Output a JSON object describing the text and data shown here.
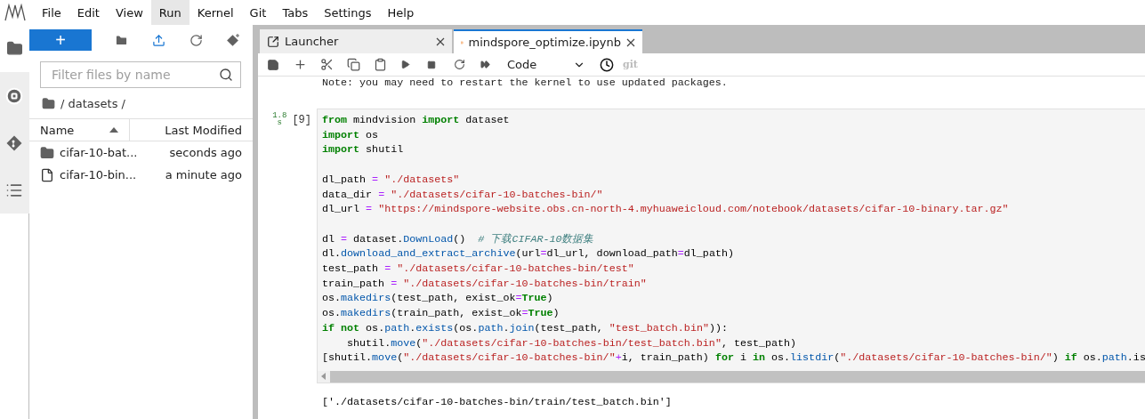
{
  "menu": [
    {
      "label": "File",
      "selected": false
    },
    {
      "label": "Edit",
      "selected": false
    },
    {
      "label": "View",
      "selected": false
    },
    {
      "label": "Run",
      "selected": true
    },
    {
      "label": "Kernel",
      "selected": false
    },
    {
      "label": "Git",
      "selected": false
    },
    {
      "label": "Tabs",
      "selected": false
    },
    {
      "label": "Settings",
      "selected": false
    },
    {
      "label": "Help",
      "selected": false
    }
  ],
  "side_tabs": [
    {
      "kind": "folder",
      "selected": true
    },
    {
      "kind": "stop",
      "selected": false
    },
    {
      "kind": "git",
      "selected": false
    },
    {
      "kind": "list",
      "selected": false
    }
  ],
  "file_browser": {
    "new_button": "+",
    "filter": {
      "placeholder": "Filter files by name"
    },
    "path": "/ datasets /",
    "columns": [
      {
        "label": "Name",
        "sorted": true
      },
      {
        "label": "Last Modified",
        "sorted": false
      }
    ],
    "rows": [
      {
        "kind": "folder",
        "name": "cifar-10-bat...",
        "modified": "seconds ago"
      },
      {
        "kind": "file",
        "name": "cifar-10-bin...",
        "modified": "a minute ago"
      }
    ]
  },
  "tabs": [
    {
      "kind": "launcher",
      "label": "Launcher",
      "selected": false
    },
    {
      "kind": "notebook",
      "label": "mindspore_optimize.ipynb",
      "selected": true
    }
  ],
  "toolbar": {
    "cell_type": "Code",
    "git": "git"
  },
  "notebook": {
    "note": "Note: you may need to restart the kernel to use updated packages.",
    "cell": {
      "time": "1.8",
      "time_unit": "s",
      "prompt": "[9]",
      "blocks": [
        [
          [
            {
              "kind": "kw",
              "text": "from"
            },
            {
              "kind": "plain",
              "text": " mindvision "
            },
            {
              "kind": "kw",
              "text": "import"
            },
            {
              "kind": "plain",
              "text": " dataset"
            }
          ],
          [
            {
              "kind": "kw",
              "text": "import"
            },
            {
              "kind": "plain",
              "text": " os"
            }
          ],
          [
            {
              "kind": "kw",
              "text": "import"
            },
            {
              "kind": "plain",
              "text": " shutil"
            }
          ]
        ],
        [
          [
            {
              "kind": "plain",
              "text": "dl_path "
            },
            {
              "kind": "op",
              "text": "="
            },
            {
              "kind": "str",
              "text": " \"./datasets\""
            }
          ],
          [
            {
              "kind": "plain",
              "text": "data_dir "
            },
            {
              "kind": "op",
              "text": "="
            },
            {
              "kind": "str",
              "text": " \"./datasets/cifar-10-batches-bin/\""
            }
          ],
          [
            {
              "kind": "plain",
              "text": "dl_url "
            },
            {
              "kind": "op",
              "text": "="
            },
            {
              "kind": "str",
              "text": " \"https://mindspore-website.obs.cn-north-4.myhuaweicloud.com/notebook/datasets/cifar-10-binary.tar.gz\""
            }
          ]
        ],
        [
          [
            {
              "kind": "plain",
              "text": "dl "
            },
            {
              "kind": "op",
              "text": "="
            },
            {
              "kind": "plain",
              "text": " dataset."
            },
            {
              "kind": "fn",
              "text": "DownLoad"
            },
            {
              "kind": "plain",
              "text": "()  "
            },
            {
              "kind": "cm",
              "text": "# 下载CIFAR-10数据集"
            }
          ],
          [
            {
              "kind": "plain",
              "text": "dl."
            },
            {
              "kind": "fn",
              "text": "download_and_extract_archive"
            },
            {
              "kind": "plain",
              "text": "(url"
            },
            {
              "kind": "op",
              "text": "="
            },
            {
              "kind": "plain",
              "text": "dl_url, download_path"
            },
            {
              "kind": "op",
              "text": "="
            },
            {
              "kind": "plain",
              "text": "dl_path)"
            }
          ],
          [
            {
              "kind": "plain",
              "text": "test_path "
            },
            {
              "kind": "op",
              "text": "="
            },
            {
              "kind": "str",
              "text": " \"./datasets/cifar-10-batches-bin/test\""
            }
          ],
          [
            {
              "kind": "plain",
              "text": "train_path "
            },
            {
              "kind": "op",
              "text": "="
            },
            {
              "kind": "str",
              "text": " \"./datasets/cifar-10-batches-bin/train\""
            }
          ],
          [
            {
              "kind": "plain",
              "text": "os."
            },
            {
              "kind": "fn",
              "text": "makedirs"
            },
            {
              "kind": "plain",
              "text": "(test_path, exist_ok"
            },
            {
              "kind": "op",
              "text": "="
            },
            {
              "kind": "kw",
              "text": "True"
            },
            {
              "kind": "plain",
              "text": ")"
            }
          ],
          [
            {
              "kind": "plain",
              "text": "os."
            },
            {
              "kind": "fn",
              "text": "makedirs"
            },
            {
              "kind": "plain",
              "text": "(train_path, exist_ok"
            },
            {
              "kind": "op",
              "text": "="
            },
            {
              "kind": "kw",
              "text": "True"
            },
            {
              "kind": "plain",
              "text": ")"
            }
          ],
          [
            {
              "kind": "kw",
              "text": "if not"
            },
            {
              "kind": "plain",
              "text": " os."
            },
            {
              "kind": "fn",
              "text": "path"
            },
            {
              "kind": "plain",
              "text": "."
            },
            {
              "kind": "fn",
              "text": "exists"
            },
            {
              "kind": "plain",
              "text": "(os."
            },
            {
              "kind": "fn",
              "text": "path"
            },
            {
              "kind": "plain",
              "text": "."
            },
            {
              "kind": "fn",
              "text": "join"
            },
            {
              "kind": "plain",
              "text": "(test_path, "
            },
            {
              "kind": "str",
              "text": "\"test_batch.bin\""
            },
            {
              "kind": "plain",
              "text": ")):"
            }
          ],
          [
            {
              "kind": "plain",
              "text": "    shutil."
            },
            {
              "kind": "fn",
              "text": "move"
            },
            {
              "kind": "plain",
              "text": "("
            },
            {
              "kind": "str",
              "text": "\"./datasets/cifar-10-batches-bin/test_batch.bin\""
            },
            {
              "kind": "plain",
              "text": ", test_path)"
            }
          ],
          [
            {
              "kind": "plain",
              "text": "[shutil."
            },
            {
              "kind": "fn",
              "text": "move"
            },
            {
              "kind": "plain",
              "text": "("
            },
            {
              "kind": "str",
              "text": "\"./datasets/cifar-10-batches-bin/\""
            },
            {
              "kind": "op",
              "text": "+"
            },
            {
              "kind": "plain",
              "text": "i, train_path) "
            },
            {
              "kind": "kw",
              "text": "for"
            },
            {
              "kind": "plain",
              "text": " i "
            },
            {
              "kind": "kw",
              "text": "in"
            },
            {
              "kind": "plain",
              "text": " os."
            },
            {
              "kind": "fn",
              "text": "listdir"
            },
            {
              "kind": "plain",
              "text": "("
            },
            {
              "kind": "str",
              "text": "\"./datasets/cifar-10-batches-bin/\""
            },
            {
              "kind": "plain",
              "text": ") "
            },
            {
              "kind": "kw",
              "text": "if"
            },
            {
              "kind": "plain",
              "text": " os."
            },
            {
              "kind": "fn",
              "text": "path"
            },
            {
              "kind": "plain",
              "text": ".is"
            }
          ]
        ]
      ],
      "output": "['./datasets/cifar-10-batches-bin/train/test_batch.bin']"
    }
  }
}
